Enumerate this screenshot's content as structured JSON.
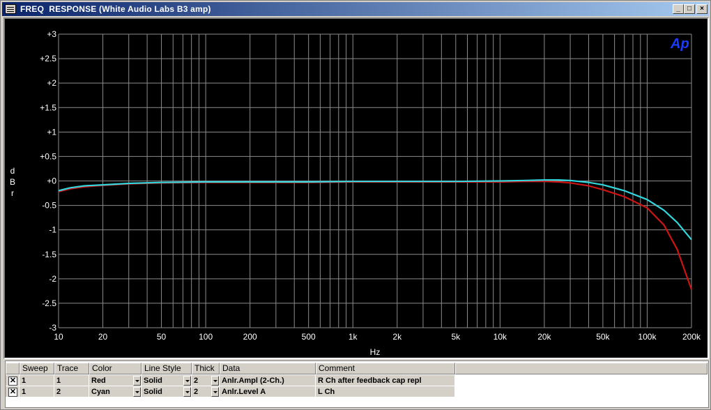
{
  "window": {
    "title": "FREQ  RESPONSE (White Audio Labs B3 amp)",
    "controls": {
      "minimize": "_",
      "maximize": "□",
      "close": "×"
    }
  },
  "plot": {
    "logo": "Ap",
    "colors": {
      "background": "#000000",
      "grid": "#8c8c8c",
      "text": "#ffffff",
      "logo": "#1a3cff"
    }
  },
  "chart_data": {
    "type": "line",
    "xlabel": "Hz",
    "ylabel": "dBr",
    "xscale": "log",
    "xlim": [
      10,
      200000
    ],
    "ylim": [
      -3,
      3
    ],
    "grid": true,
    "x_tick_labels": [
      "10",
      "20",
      "50",
      "100",
      "200",
      "500",
      "1k",
      "2k",
      "5k",
      "10k",
      "20k",
      "50k",
      "100k",
      "200k"
    ],
    "x_tick_values": [
      10,
      20,
      50,
      100,
      200,
      500,
      1000,
      2000,
      5000,
      10000,
      20000,
      50000,
      100000,
      200000
    ],
    "y_tick_labels": [
      "+3",
      "+2.5",
      "+2",
      "+1.5",
      "+1",
      "+0.5",
      "+0",
      "-0.5",
      "-1",
      "-1.5",
      "-2",
      "-2.5",
      "-3"
    ],
    "y_tick_values": [
      3,
      2.5,
      2,
      1.5,
      1,
      0.5,
      0,
      -0.5,
      -1,
      -1.5,
      -2,
      -2.5,
      -3
    ],
    "series": [
      {
        "color": "#cc1414",
        "x": [
          10,
          12,
          15,
          20,
          30,
          50,
          100,
          200,
          500,
          1000,
          2000,
          5000,
          10000,
          15000,
          20000,
          25000,
          30000,
          40000,
          50000,
          70000,
          100000,
          130000,
          160000,
          200000
        ],
        "y": [
          -0.22,
          -0.16,
          -0.12,
          -0.09,
          -0.06,
          -0.04,
          -0.03,
          -0.03,
          -0.03,
          -0.02,
          -0.02,
          -0.02,
          -0.02,
          -0.01,
          -0.01,
          -0.02,
          -0.04,
          -0.1,
          -0.18,
          -0.32,
          -0.55,
          -0.9,
          -1.4,
          -2.22
        ]
      },
      {
        "color": "#33d6dc",
        "x": [
          10,
          12,
          15,
          20,
          30,
          50,
          100,
          200,
          500,
          1000,
          2000,
          5000,
          10000,
          15000,
          20000,
          25000,
          30000,
          40000,
          50000,
          70000,
          100000,
          130000,
          160000,
          200000
        ],
        "y": [
          -0.2,
          -0.14,
          -0.1,
          -0.08,
          -0.05,
          -0.03,
          -0.02,
          -0.02,
          -0.02,
          -0.01,
          -0.01,
          -0.01,
          0.0,
          0.01,
          0.02,
          0.02,
          0.01,
          -0.03,
          -0.08,
          -0.2,
          -0.38,
          -0.6,
          -0.85,
          -1.2
        ]
      }
    ]
  },
  "table": {
    "headers": {
      "sweep": "Sweep",
      "trace": "Trace",
      "color": "Color",
      "line_style": "Line Style",
      "thick": "Thick",
      "data": "Data",
      "comment": "Comment"
    },
    "rows": [
      {
        "checked": "✕",
        "sweep": "1",
        "trace": "1",
        "color": "Red",
        "line_style": "Solid",
        "thick": "2",
        "data": "Anlr.Ampl (2-Ch.)",
        "comment": "R Ch after feedback cap repl"
      },
      {
        "checked": "✕",
        "sweep": "1",
        "trace": "2",
        "color": "Cyan",
        "line_style": "Solid",
        "thick": "2",
        "data": "Anlr.Level A",
        "comment": "L Ch"
      }
    ]
  }
}
